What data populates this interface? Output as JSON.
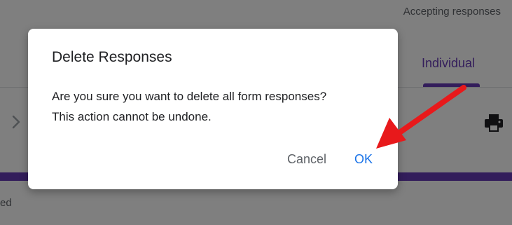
{
  "background": {
    "status_text": "Accepting responses",
    "tab_individual": "Individual",
    "bottom_partial_text": "ed"
  },
  "dialog": {
    "title": "Delete Responses",
    "message_line1": "Are you sure you want to delete all form responses?",
    "message_line2": "This action cannot be undone.",
    "cancel_label": "Cancel",
    "ok_label": "OK"
  },
  "icons": {
    "nav": "chevron-right-icon",
    "print": "print-icon",
    "annotation": "red-arrow-icon"
  },
  "colors": {
    "accent": "#673ab7",
    "button_primary": "#1a73e8",
    "annotation": "#e8191b"
  }
}
